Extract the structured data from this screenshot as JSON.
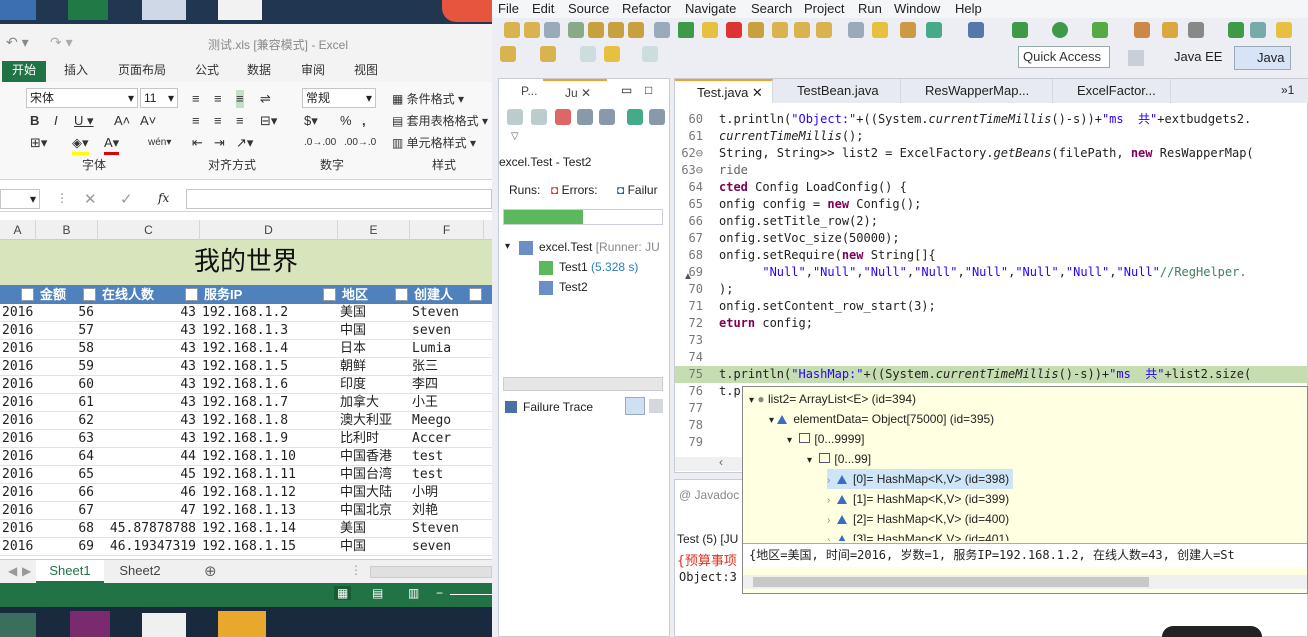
{
  "excel": {
    "title": "测试.xls  [兼容模式] - Excel",
    "tabs": [
      "开始",
      "插入",
      "页面布局",
      "公式",
      "数据",
      "审阅",
      "视图"
    ],
    "active_tab": "开始",
    "font_name": "宋体",
    "font_size": "11",
    "number_format": "常规",
    "group_labels": [
      "字体",
      "对齐方式",
      "数字",
      "样式"
    ],
    "style_buttons": [
      "条件格式",
      "套用表格格式",
      "单元格样式"
    ],
    "fx_label": "fx",
    "col_headers": [
      "A",
      "B",
      "C",
      "D",
      "E",
      "F"
    ],
    "sheet_title": "我的世界",
    "table_headers": [
      "金额",
      "在线人数",
      "服务IP",
      "地区",
      "创建人"
    ],
    "rows": [
      [
        "2016",
        "56",
        "43",
        "192.168.1.2",
        "美国",
        "Steven"
      ],
      [
        "2016",
        "57",
        "43",
        "192.168.1.3",
        "中国",
        "seven"
      ],
      [
        "2016",
        "58",
        "43",
        "192.168.1.4",
        "日本",
        "Lumia"
      ],
      [
        "2016",
        "59",
        "43",
        "192.168.1.5",
        "朝鲜",
        "张三"
      ],
      [
        "2016",
        "60",
        "43",
        "192.168.1.6",
        "印度",
        "李四"
      ],
      [
        "2016",
        "61",
        "43",
        "192.168.1.7",
        "加拿大",
        "小王"
      ],
      [
        "2016",
        "62",
        "43",
        "192.168.1.8",
        "澳大利亚",
        "Meego"
      ],
      [
        "2016",
        "63",
        "43",
        "192.168.1.9",
        "比利时",
        "Accer"
      ],
      [
        "2016",
        "64",
        "44",
        "192.168.1.10",
        "中国香港",
        "test"
      ],
      [
        "2016",
        "65",
        "45",
        "192.168.1.11",
        "中国台湾",
        "test"
      ],
      [
        "2016",
        "66",
        "46",
        "192.168.1.12",
        "中国大陆",
        "小明"
      ],
      [
        "2016",
        "67",
        "47",
        "192.168.1.13",
        "中国北京",
        "刘艳"
      ],
      [
        "2016",
        "68",
        "45.87878788",
        "192.168.1.14",
        "美国",
        "Steven"
      ],
      [
        "2016",
        "69",
        "46.19347319",
        "192.168.1.15",
        "中国",
        "seven"
      ]
    ],
    "sheet_tabs": [
      "Sheet1",
      "Sheet2"
    ],
    "active_sheet": "Sheet1"
  },
  "eclipse": {
    "menu": [
      "File",
      "Edit",
      "Source",
      "Refactor",
      "Navigate",
      "Search",
      "Project",
      "Run",
      "Window",
      "Help"
    ],
    "quick_access": "Quick Access",
    "perspectives": [
      "Java EE",
      "Java"
    ],
    "junit": {
      "tab_short": "Ju",
      "tab_other": "P...",
      "run_title": "excel.Test - Test2",
      "runs_label": "Runs:",
      "errors_label": "Errors:",
      "failures_label": "Failur",
      "progress": 0.5,
      "tree_root": "excel.Test",
      "tree_root_runner": "[Runner: JU",
      "tests": [
        {
          "name": "Test1",
          "time": "(5.328 s)"
        },
        {
          "name": "Test2",
          "time": ""
        }
      ],
      "failure_trace": "Failure Trace"
    },
    "editor_tabs": [
      "Test.java",
      "TestBean.java",
      "ResWapperMap...",
      "ExcelFactor..."
    ],
    "editor_overflow": "»1",
    "bottom_tabs": [
      "Javadoc",
      "Test (5) [JU"
    ],
    "bottom_text1": "{预算事项",
    "bottom_text2": "Object:3",
    "debug": {
      "root": "list2= ArrayList<E>  (id=394)",
      "element": "elementData= Object[75000]  (id=395)",
      "range1": "[0...9999]",
      "range2": "[0...99]",
      "items": [
        "[0]= HashMap<K,V>  (id=398)",
        "[1]= HashMap<K,V>  (id=399)",
        "[2]= HashMap<K,V>  (id=400)",
        "[3]= HashMap<K,V>  (id=401)"
      ],
      "detail": "{地区=美国, 时间=2016, 岁数=1, 服务IP=192.168.1.2, 在线人数=43, 创建人=St"
    }
  }
}
